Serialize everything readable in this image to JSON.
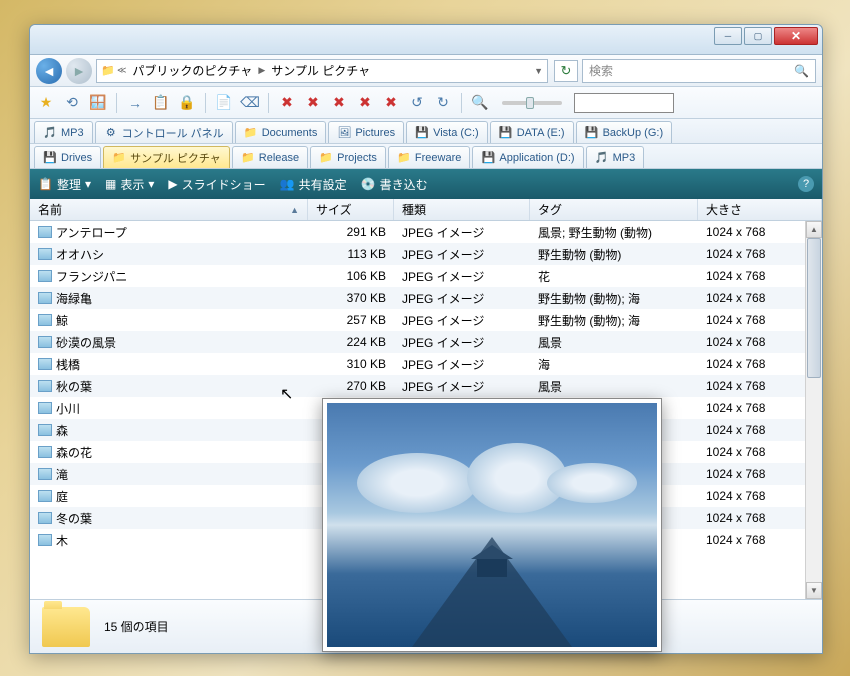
{
  "titlebar": {
    "min": "─",
    "max": "▢",
    "close": "✕"
  },
  "nav": {
    "back": "◄",
    "fwd": "►",
    "breadcrumb": [
      "パブリックのピクチャ",
      "サンプル ピクチャ"
    ],
    "refresh": "↻",
    "search_placeholder": "検索",
    "search_icon": "🔍"
  },
  "toolbar_icons": [
    "★",
    "⟲",
    "🪟",
    "→",
    "📋",
    "🔒",
    "📄",
    "⌫",
    "✖",
    "✖",
    "✖",
    "✖",
    "✖",
    "↺",
    "↻",
    "🔍"
  ],
  "tabs_row1": [
    {
      "icon": "🎵",
      "label": "MP3"
    },
    {
      "icon": "⚙",
      "label": "コントロール パネル"
    },
    {
      "icon": "📁",
      "label": "Documents"
    },
    {
      "icon": "🖼",
      "label": "Pictures"
    },
    {
      "icon": "💾",
      "label": "Vista (C:)"
    },
    {
      "icon": "💾",
      "label": "DATA (E:)"
    },
    {
      "icon": "💾",
      "label": "BackUp (G:)"
    }
  ],
  "tabs_row2": [
    {
      "icon": "💾",
      "label": "Drives",
      "active": false
    },
    {
      "icon": "📁",
      "label": "サンプル ピクチャ",
      "active": true
    },
    {
      "icon": "📁",
      "label": "Release",
      "active": false
    },
    {
      "icon": "📁",
      "label": "Projects",
      "active": false
    },
    {
      "icon": "📁",
      "label": "Freeware",
      "active": false
    },
    {
      "icon": "💾",
      "label": "Application (D:)",
      "active": false
    },
    {
      "icon": "🎵",
      "label": "MP3",
      "active": false
    }
  ],
  "cmdbar": {
    "organize": "整理",
    "view": "表示",
    "slideshow": "スライドショー",
    "share": "共有設定",
    "burn": "書き込む"
  },
  "columns": {
    "name": "名前",
    "size": "サイズ",
    "type": "種類",
    "tag": "タグ",
    "dim": "大きさ"
  },
  "files": [
    {
      "name": "アンテロープ",
      "size": "291 KB",
      "type": "JPEG イメージ",
      "tag": "風景; 野生動物 (動物)",
      "dim": "1024 x 768"
    },
    {
      "name": "オオハシ",
      "size": "113 KB",
      "type": "JPEG イメージ",
      "tag": "野生動物 (動物)",
      "dim": "1024 x 768"
    },
    {
      "name": "フランジパニ",
      "size": "106 KB",
      "type": "JPEG イメージ",
      "tag": "花",
      "dim": "1024 x 768"
    },
    {
      "name": "海緑亀",
      "size": "370 KB",
      "type": "JPEG イメージ",
      "tag": "野生動物 (動物); 海",
      "dim": "1024 x 768"
    },
    {
      "name": "鯨",
      "size": "257 KB",
      "type": "JPEG イメージ",
      "tag": "野生動物 (動物); 海",
      "dim": "1024 x 768"
    },
    {
      "name": "砂漠の風景",
      "size": "224 KB",
      "type": "JPEG イメージ",
      "tag": "風景",
      "dim": "1024 x 768"
    },
    {
      "name": "桟橋",
      "size": "310 KB",
      "type": "JPEG イメージ",
      "tag": "海",
      "dim": "1024 x 768"
    },
    {
      "name": "秋の葉",
      "size": "270 KB",
      "type": "JPEG イメージ",
      "tag": "風景",
      "dim": "1024 x 768"
    },
    {
      "name": "小川",
      "size": "",
      "type": "",
      "tag": "",
      "dim": "1024 x 768"
    },
    {
      "name": "森",
      "size": "",
      "type": "",
      "tag": "",
      "dim": "1024 x 768"
    },
    {
      "name": "森の花",
      "size": "",
      "type": "",
      "tag": "",
      "dim": "1024 x 768"
    },
    {
      "name": "滝",
      "size": "",
      "type": "",
      "tag": "",
      "dim": "1024 x 768"
    },
    {
      "name": "庭",
      "size": "",
      "type": "",
      "tag": "",
      "dim": "1024 x 768"
    },
    {
      "name": "冬の葉",
      "size": "",
      "type": "",
      "tag": "",
      "dim": "1024 x 768"
    },
    {
      "name": "木",
      "size": "",
      "type": "",
      "tag": "",
      "dim": "1024 x 768"
    }
  ],
  "status": {
    "count": "15 個の項目"
  }
}
